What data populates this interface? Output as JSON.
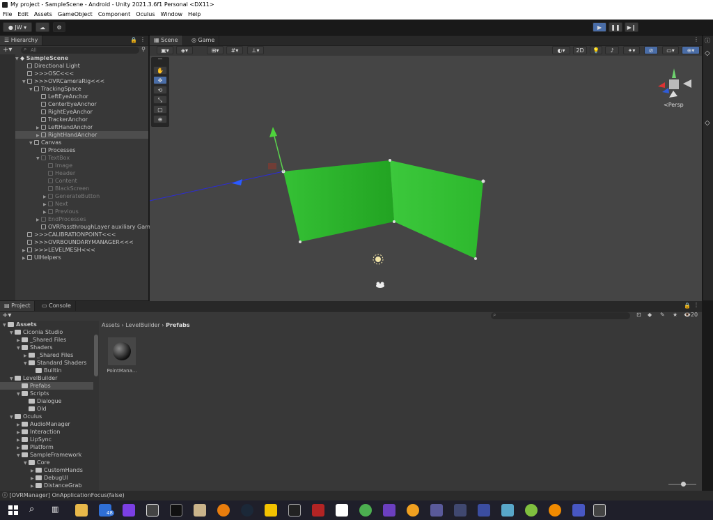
{
  "window": {
    "title": "My project - SampleScene - Android - Unity 2021.3.6f1 Personal <DX11>"
  },
  "menu": [
    "File",
    "Edit",
    "Assets",
    "GameObject",
    "Component",
    "Oculus",
    "Window",
    "Help"
  ],
  "toolbar": {
    "account": "JW"
  },
  "hierarchy": {
    "tab_label": "Hierarchy",
    "search_placeholder": "All",
    "items": [
      {
        "label": "SampleScene",
        "indent": 0,
        "arrow": "down",
        "type": "scene"
      },
      {
        "label": "Directional Light",
        "indent": 1,
        "arrow": "",
        "type": "obj"
      },
      {
        "label": ">>>OSC<<<",
        "indent": 1,
        "arrow": "",
        "type": "obj"
      },
      {
        "label": ">>>OVRCameraRig<<<",
        "indent": 1,
        "arrow": "down",
        "type": "obj"
      },
      {
        "label": "TrackingSpace",
        "indent": 2,
        "arrow": "down",
        "type": "obj"
      },
      {
        "label": "LeftEyeAnchor",
        "indent": 3,
        "arrow": "",
        "type": "obj"
      },
      {
        "label": "CenterEyeAnchor",
        "indent": 3,
        "arrow": "",
        "type": "obj"
      },
      {
        "label": "RightEyeAnchor",
        "indent": 3,
        "arrow": "",
        "type": "obj"
      },
      {
        "label": "TrackerAnchor",
        "indent": 3,
        "arrow": "",
        "type": "obj"
      },
      {
        "label": "LeftHandAnchor",
        "indent": 3,
        "arrow": "right",
        "type": "obj"
      },
      {
        "label": "RightHandAnchor",
        "indent": 3,
        "arrow": "right",
        "type": "obj",
        "selected": true
      },
      {
        "label": "Canvas",
        "indent": 2,
        "arrow": "down",
        "type": "obj"
      },
      {
        "label": "Processes",
        "indent": 3,
        "arrow": "",
        "type": "obj"
      },
      {
        "label": "TextBox",
        "indent": 3,
        "arrow": "down",
        "type": "obj",
        "dim": true
      },
      {
        "label": "Image",
        "indent": 4,
        "arrow": "",
        "type": "obj",
        "dim": true
      },
      {
        "label": "Header",
        "indent": 4,
        "arrow": "",
        "type": "obj",
        "dim": true
      },
      {
        "label": "Content",
        "indent": 4,
        "arrow": "",
        "type": "obj",
        "dim": true
      },
      {
        "label": "BlackScreen",
        "indent": 4,
        "arrow": "",
        "type": "obj",
        "dim": true
      },
      {
        "label": "GenerateButton",
        "indent": 4,
        "arrow": "right",
        "type": "obj",
        "dim": true
      },
      {
        "label": "Next",
        "indent": 4,
        "arrow": "right",
        "type": "obj",
        "dim": true
      },
      {
        "label": "Previous",
        "indent": 4,
        "arrow": "right",
        "type": "obj",
        "dim": true
      },
      {
        "label": "EndProcesses",
        "indent": 3,
        "arrow": "right",
        "type": "obj",
        "dim": true
      },
      {
        "label": "OVRPassthroughLayer auxiliary GameO",
        "indent": 3,
        "arrow": "",
        "type": "obj"
      },
      {
        "label": ">>>CALIBRATIONPOINT<<<",
        "indent": 1,
        "arrow": "",
        "type": "obj"
      },
      {
        "label": ">>>OVRBOUNDARYMANAGER<<<",
        "indent": 1,
        "arrow": "",
        "type": "obj"
      },
      {
        "label": ">>>LEVELMESH<<<",
        "indent": 1,
        "arrow": "right",
        "type": "obj"
      },
      {
        "label": "UIHelpers",
        "indent": 1,
        "arrow": "right",
        "type": "obj"
      }
    ]
  },
  "scene": {
    "tabs": [
      {
        "label": "Scene"
      },
      {
        "label": "Game"
      }
    ],
    "view_2d": "2D",
    "persp_label": "<Persp"
  },
  "project": {
    "tabs": [
      {
        "label": "Project"
      },
      {
        "label": "Console"
      }
    ],
    "breadcrumb": [
      "Assets",
      "LevelBuilder",
      "Prefabs"
    ],
    "hidden_count": "20",
    "tree": [
      {
        "label": "Assets",
        "indent": 0,
        "arrow": "down",
        "bold": true
      },
      {
        "label": "Ciconia Studio",
        "indent": 1,
        "arrow": "down"
      },
      {
        "label": "_Shared Files",
        "indent": 2,
        "arrow": "right"
      },
      {
        "label": "Shaders",
        "indent": 2,
        "arrow": "down"
      },
      {
        "label": "_Shared Files",
        "indent": 3,
        "arrow": "right"
      },
      {
        "label": "Standard Shaders",
        "indent": 3,
        "arrow": "down"
      },
      {
        "label": "Builtin",
        "indent": 4,
        "arrow": ""
      },
      {
        "label": "LevelBuilder",
        "indent": 1,
        "arrow": "down"
      },
      {
        "label": "Prefabs",
        "indent": 2,
        "arrow": "",
        "selected": true
      },
      {
        "label": "Scripts",
        "indent": 2,
        "arrow": "down"
      },
      {
        "label": "Dialogue",
        "indent": 3,
        "arrow": ""
      },
      {
        "label": "Old",
        "indent": 3,
        "arrow": ""
      },
      {
        "label": "Oculus",
        "indent": 1,
        "arrow": "down"
      },
      {
        "label": "AudioManager",
        "indent": 2,
        "arrow": "right"
      },
      {
        "label": "Interaction",
        "indent": 2,
        "arrow": "right"
      },
      {
        "label": "LipSync",
        "indent": 2,
        "arrow": "right"
      },
      {
        "label": "Platform",
        "indent": 2,
        "arrow": "right"
      },
      {
        "label": "SampleFramework",
        "indent": 2,
        "arrow": "down"
      },
      {
        "label": "Core",
        "indent": 3,
        "arrow": "down"
      },
      {
        "label": "CustomHands",
        "indent": 4,
        "arrow": "right"
      },
      {
        "label": "DebugUI",
        "indent": 4,
        "arrow": "right"
      },
      {
        "label": "DistanceGrab",
        "indent": 4,
        "arrow": "right"
      }
    ],
    "assets": [
      {
        "label": "PointMana..."
      }
    ]
  },
  "status": {
    "message": "[OVRManager] OnApplicationFocus(false)"
  },
  "taskbar": {
    "badge": "48"
  },
  "colors": {
    "accent": "#4a6da7",
    "panel": "#383838",
    "wall": "#2fb52f"
  }
}
